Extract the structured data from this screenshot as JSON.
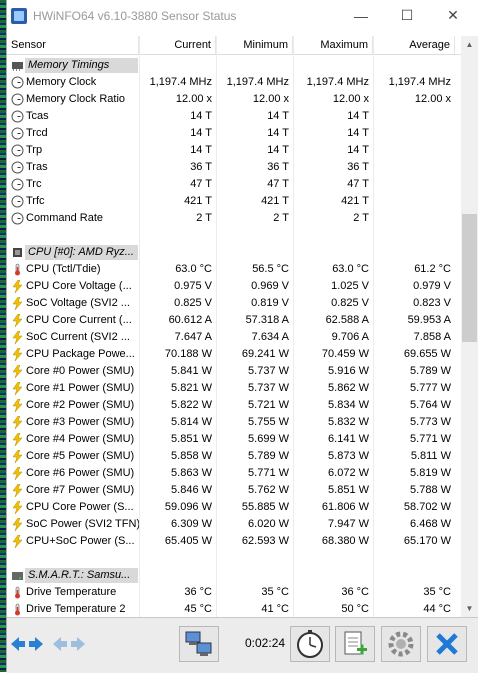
{
  "window": {
    "title": "HWiNFO64 v6.10-3880 Sensor Status",
    "minimize_glyph": "—",
    "maximize_glyph": "☐",
    "close_glyph": "✕"
  },
  "columns": {
    "sensor": "Sensor",
    "current": "Current",
    "minimum": "Minimum",
    "maximum": "Maximum",
    "average": "Average"
  },
  "rows": [
    {
      "kind": "group",
      "icon": "memory-chip-icon",
      "name": "Memory Timings"
    },
    {
      "kind": "sensor",
      "icon": "clock-icon",
      "name": "Memory Clock",
      "cur": "1,197.4 MHz",
      "min": "1,197.4 MHz",
      "max": "1,197.4 MHz",
      "avg": "1,197.4 MHz"
    },
    {
      "kind": "sensor",
      "icon": "clock-icon",
      "name": "Memory Clock Ratio",
      "cur": "12.00 x",
      "min": "12.00 x",
      "max": "12.00 x",
      "avg": "12.00 x"
    },
    {
      "kind": "sensor",
      "icon": "clock-icon",
      "name": "Tcas",
      "cur": "14 T",
      "min": "14 T",
      "max": "14 T",
      "avg": ""
    },
    {
      "kind": "sensor",
      "icon": "clock-icon",
      "name": "Trcd",
      "cur": "14 T",
      "min": "14 T",
      "max": "14 T",
      "avg": ""
    },
    {
      "kind": "sensor",
      "icon": "clock-icon",
      "name": "Trp",
      "cur": "14 T",
      "min": "14 T",
      "max": "14 T",
      "avg": ""
    },
    {
      "kind": "sensor",
      "icon": "clock-icon",
      "name": "Tras",
      "cur": "36 T",
      "min": "36 T",
      "max": "36 T",
      "avg": ""
    },
    {
      "kind": "sensor",
      "icon": "clock-icon",
      "name": "Trc",
      "cur": "47 T",
      "min": "47 T",
      "max": "47 T",
      "avg": ""
    },
    {
      "kind": "sensor",
      "icon": "clock-icon",
      "name": "Trfc",
      "cur": "421 T",
      "min": "421 T",
      "max": "421 T",
      "avg": ""
    },
    {
      "kind": "sensor",
      "icon": "clock-icon",
      "name": "Command Rate",
      "cur": "2 T",
      "min": "2 T",
      "max": "2 T",
      "avg": ""
    },
    {
      "kind": "blank"
    },
    {
      "kind": "group",
      "icon": "cpu-chip-icon",
      "name": "CPU [#0]: AMD Ryz..."
    },
    {
      "kind": "sensor",
      "icon": "thermometer-icon",
      "name": "CPU (Tctl/Tdie)",
      "cur": "63.0 °C",
      "min": "56.5 °C",
      "max": "63.0 °C",
      "avg": "61.2 °C"
    },
    {
      "kind": "sensor",
      "icon": "lightning-icon",
      "name": "CPU Core Voltage (...",
      "cur": "0.975 V",
      "min": "0.969 V",
      "max": "1.025 V",
      "avg": "0.979 V"
    },
    {
      "kind": "sensor",
      "icon": "lightning-icon",
      "name": "SoC Voltage (SVI2 ...",
      "cur": "0.825 V",
      "min": "0.819 V",
      "max": "0.825 V",
      "avg": "0.823 V"
    },
    {
      "kind": "sensor",
      "icon": "lightning-icon",
      "name": "CPU Core Current (...",
      "cur": "60.612 A",
      "min": "57.318 A",
      "max": "62.588 A",
      "avg": "59.953 A"
    },
    {
      "kind": "sensor",
      "icon": "lightning-icon",
      "name": "SoC Current (SVI2 ...",
      "cur": "7.647 A",
      "min": "7.634 A",
      "max": "9.706 A",
      "avg": "7.858 A"
    },
    {
      "kind": "sensor",
      "icon": "lightning-icon",
      "name": "CPU Package Powe...",
      "cur": "70.188 W",
      "min": "69.241 W",
      "max": "70.459 W",
      "avg": "69.655 W"
    },
    {
      "kind": "sensor",
      "icon": "lightning-icon",
      "name": "Core #0 Power (SMU)",
      "cur": "5.841 W",
      "min": "5.737 W",
      "max": "5.916 W",
      "avg": "5.789 W"
    },
    {
      "kind": "sensor",
      "icon": "lightning-icon",
      "name": "Core #1 Power (SMU)",
      "cur": "5.821 W",
      "min": "5.737 W",
      "max": "5.862 W",
      "avg": "5.777 W"
    },
    {
      "kind": "sensor",
      "icon": "lightning-icon",
      "name": "Core #2 Power (SMU)",
      "cur": "5.822 W",
      "min": "5.721 W",
      "max": "5.834 W",
      "avg": "5.764 W"
    },
    {
      "kind": "sensor",
      "icon": "lightning-icon",
      "name": "Core #3 Power (SMU)",
      "cur": "5.814 W",
      "min": "5.755 W",
      "max": "5.832 W",
      "avg": "5.773 W"
    },
    {
      "kind": "sensor",
      "icon": "lightning-icon",
      "name": "Core #4 Power (SMU)",
      "cur": "5.851 W",
      "min": "5.699 W",
      "max": "6.141 W",
      "avg": "5.771 W"
    },
    {
      "kind": "sensor",
      "icon": "lightning-icon",
      "name": "Core #5 Power (SMU)",
      "cur": "5.858 W",
      "min": "5.789 W",
      "max": "5.873 W",
      "avg": "5.811 W"
    },
    {
      "kind": "sensor",
      "icon": "lightning-icon",
      "name": "Core #6 Power (SMU)",
      "cur": "5.863 W",
      "min": "5.771 W",
      "max": "6.072 W",
      "avg": "5.819 W"
    },
    {
      "kind": "sensor",
      "icon": "lightning-icon",
      "name": "Core #7 Power (SMU)",
      "cur": "5.846 W",
      "min": "5.762 W",
      "max": "5.851 W",
      "avg": "5.788 W"
    },
    {
      "kind": "sensor",
      "icon": "lightning-icon",
      "name": "CPU Core Power (S...",
      "cur": "59.096 W",
      "min": "55.885 W",
      "max": "61.806 W",
      "avg": "58.702 W"
    },
    {
      "kind": "sensor",
      "icon": "lightning-icon",
      "name": "SoC Power (SVI2 TFN)",
      "cur": "6.309 W",
      "min": "6.020 W",
      "max": "7.947 W",
      "avg": "6.468 W"
    },
    {
      "kind": "sensor",
      "icon": "lightning-icon",
      "name": "CPU+SoC Power (S...",
      "cur": "65.405 W",
      "min": "62.593 W",
      "max": "68.380 W",
      "avg": "65.170 W"
    },
    {
      "kind": "blank"
    },
    {
      "kind": "group",
      "icon": "drive-icon",
      "name": "S.M.A.R.T.: Samsu..."
    },
    {
      "kind": "sensor",
      "icon": "thermometer-icon",
      "name": "Drive Temperature",
      "cur": "36 °C",
      "min": "35 °C",
      "max": "36 °C",
      "avg": "35 °C"
    },
    {
      "kind": "sensor",
      "icon": "thermometer-icon",
      "name": "Drive Temperature 2",
      "cur": "45 °C",
      "min": "41 °C",
      "max": "50 °C",
      "avg": "44 °C"
    }
  ],
  "footer": {
    "elapsed": "0:02:24",
    "buttons": [
      "nav-arrows-icon",
      "nav-arrows-disabled-icon",
      "network-computers-icon",
      "stopwatch-icon",
      "add-report-icon",
      "settings-gear-icon",
      "close-x-icon"
    ]
  },
  "colors": {
    "accent_blue": "#2a7fd4",
    "lightning_yellow": "#f2c200",
    "thermometer_red": "#d23a2a",
    "group_bg": "#d9d9d9"
  }
}
